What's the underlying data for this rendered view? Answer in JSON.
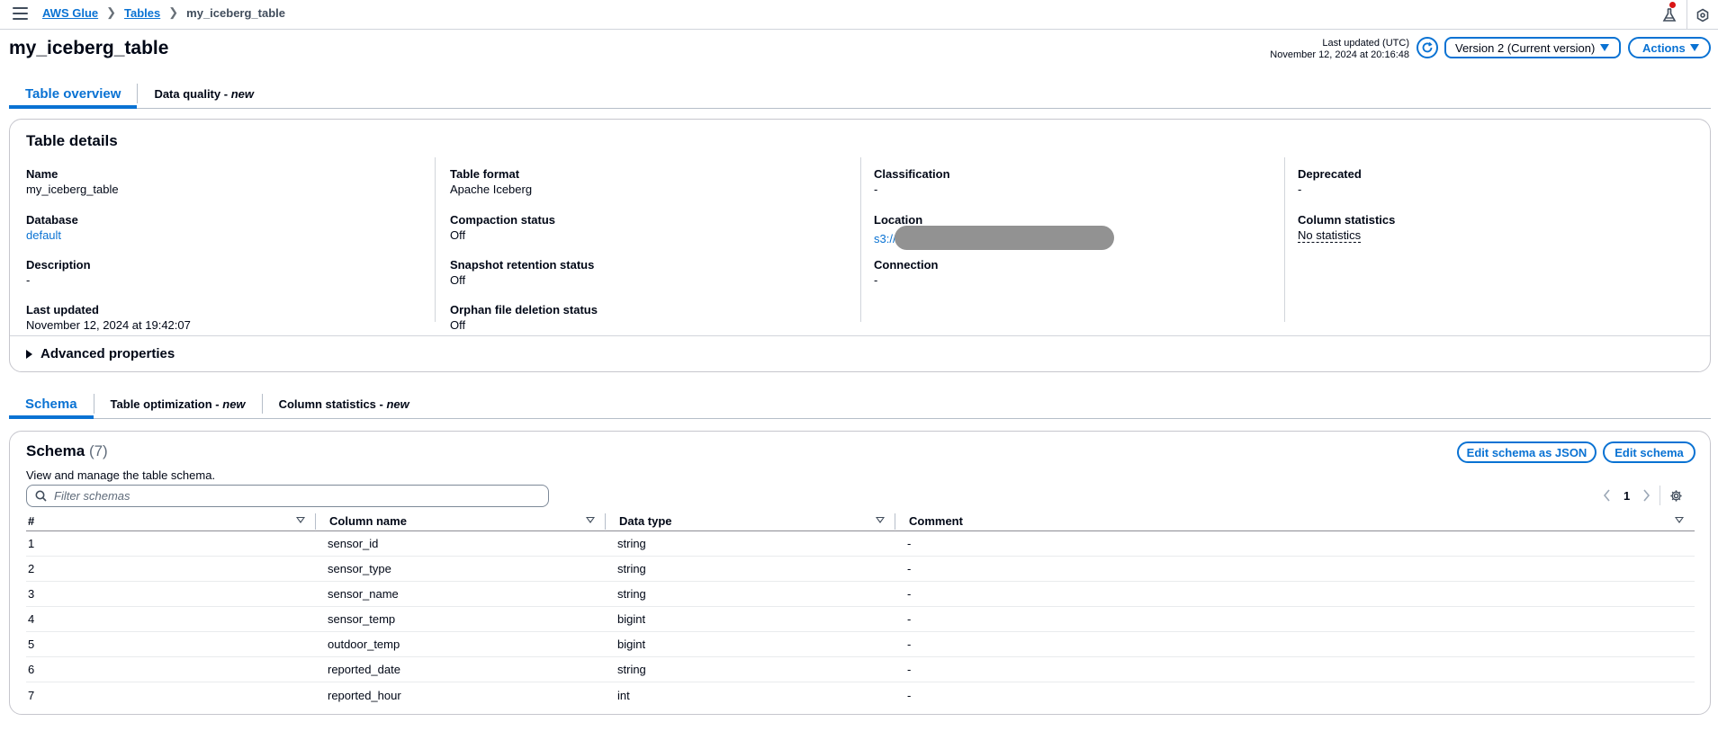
{
  "breadcrumb": {
    "root": "AWS Glue",
    "tables": "Tables",
    "current": "my_iceberg_table"
  },
  "page": {
    "title": "my_iceberg_table",
    "last_updated_label": "Last updated (UTC)",
    "last_updated_value": "November 12, 2024 at 20:16:48",
    "version_select": "Version 2 (Current version)",
    "actions_label": "Actions"
  },
  "top_tabs": [
    {
      "label": "Table overview",
      "suffix": ""
    },
    {
      "label": "Data quality - ",
      "suffix": "new"
    }
  ],
  "details": {
    "title": "Table details",
    "col1": [
      {
        "key": "Name",
        "value": "my_iceberg_table"
      },
      {
        "key": "Database",
        "value": "default"
      },
      {
        "key": "Description",
        "value": "-"
      },
      {
        "key": "Last updated",
        "value": "November 12, 2024 at 19:42:07"
      }
    ],
    "col2": [
      {
        "key": "Table format",
        "value": "Apache Iceberg"
      },
      {
        "key": "Compaction status",
        "value": "Off"
      },
      {
        "key": "Snapshot retention status",
        "value": "Off"
      },
      {
        "key": "Orphan file deletion status",
        "value": "Off"
      }
    ],
    "col3": [
      {
        "key": "Classification",
        "value": "-"
      },
      {
        "key": "Location",
        "value": "s3://"
      },
      {
        "key": "Connection",
        "value": "-"
      }
    ],
    "col4": [
      {
        "key": "Deprecated",
        "value": "-"
      },
      {
        "key": "Column statistics",
        "value": "No statistics"
      }
    ],
    "advanced": "Advanced properties"
  },
  "bottom_tabs": [
    {
      "label": "Schema",
      "suffix": ""
    },
    {
      "label": "Table optimization - ",
      "suffix": "new"
    },
    {
      "label": "Column statistics - ",
      "suffix": "new"
    }
  ],
  "schema": {
    "title": "Schema",
    "count": "(7)",
    "description": "View and manage the table schema.",
    "edit_json_label": "Edit schema as JSON",
    "edit_label": "Edit schema",
    "filter_placeholder": "Filter schemas",
    "page": "1",
    "headers": [
      "#",
      "Column name",
      "Data type",
      "Comment"
    ],
    "rows": [
      [
        "1",
        "sensor_id",
        "string",
        "-"
      ],
      [
        "2",
        "sensor_type",
        "string",
        "-"
      ],
      [
        "3",
        "sensor_name",
        "string",
        "-"
      ],
      [
        "4",
        "sensor_temp",
        "bigint",
        "-"
      ],
      [
        "5",
        "outdoor_temp",
        "bigint",
        "-"
      ],
      [
        "6",
        "reported_date",
        "string",
        "-"
      ],
      [
        "7",
        "reported_hour",
        "int",
        "-"
      ]
    ]
  },
  "colors": {
    "accent": "#0972d3",
    "text": "#000716",
    "notification": "#d91515"
  },
  "icons": [
    "menu-icon",
    "flask-icon",
    "help-icon",
    "refresh-icon",
    "search-icon",
    "chevron-left-icon",
    "chevron-right-icon",
    "gear-icon",
    "caret-right-icon",
    "sort-icon"
  ]
}
